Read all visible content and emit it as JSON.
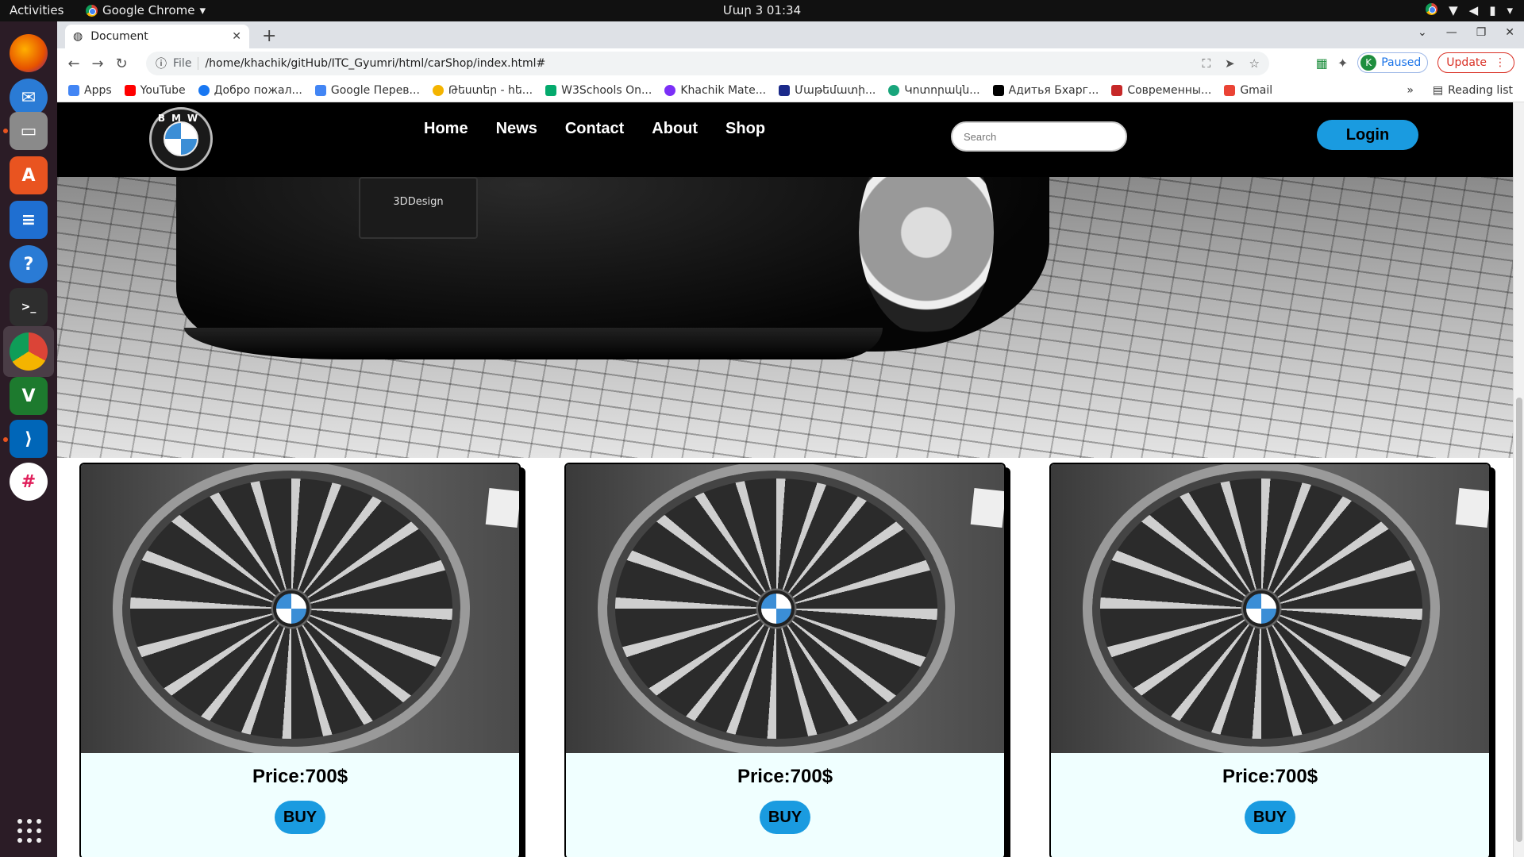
{
  "system": {
    "activities": "Activities",
    "app_name": "Google Chrome",
    "clock": "Մար 3  01:34"
  },
  "browser": {
    "tab_title": "Document",
    "url_protocol": "File",
    "url": "/home/khachik/gitHub/ITC_Gyumri/html/carShop/index.html#",
    "profile_initial": "K",
    "profile_status": "Paused",
    "update_label": "Update",
    "bookmarks": [
      {
        "label": "Apps",
        "color": "#4285f4"
      },
      {
        "label": "YouTube",
        "color": "#ff0000"
      },
      {
        "label": "Добро пожал...",
        "color": "#1877f2"
      },
      {
        "label": "Google Перев...",
        "color": "#4285f4"
      },
      {
        "label": "Թեստեր - հե...",
        "color": "#f4b400"
      },
      {
        "label": "W3Schools On...",
        "color": "#04aa6d"
      },
      {
        "label": "Khachik Mate...",
        "color": "#7b2ff7"
      },
      {
        "label": "Մաթեմատի...",
        "color": "#1b2a8a"
      },
      {
        "label": "Կոտորակն...",
        "color": "#18a57b"
      },
      {
        "label": "Адитья Бхарг...",
        "color": "#000000"
      },
      {
        "label": "Современны...",
        "color": "#c62828"
      },
      {
        "label": "Gmail",
        "color": "#ea4335"
      }
    ],
    "reading_list": "Reading list"
  },
  "site": {
    "logo_letters": "BMW",
    "nav": [
      "Home",
      "News",
      "Contact",
      "About",
      "Shop"
    ],
    "search_placeholder": "Search",
    "login_label": "Login",
    "hero_plate": "3DDesign",
    "products": [
      {
        "price": "Price:700$",
        "buy_label": "BUY"
      },
      {
        "price": "Price:700$",
        "buy_label": "BUY"
      },
      {
        "price": "Price:700$",
        "buy_label": "BUY"
      }
    ]
  },
  "colors": {
    "accent": "#1a9be0",
    "card_bg": "#f0ffff"
  }
}
